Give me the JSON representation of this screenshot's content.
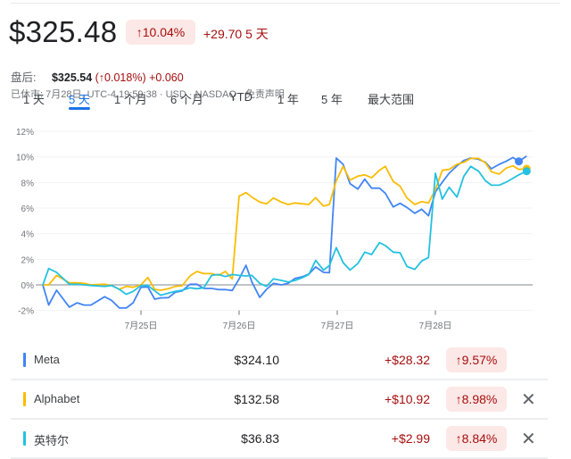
{
  "header": {
    "price": "$325.48",
    "change_pct": "↑10.04%",
    "change_abs": "+29.70",
    "period": "5 天",
    "after_hours_label": "盘后:",
    "after_hours_price": "$325.54",
    "after_hours_pct": "(↑0.018%)",
    "after_hours_change": "+0.060",
    "market_info": "已休市:  7月28日, UTC-4 19:59:38 · USD · NASDAQ · 免责声明"
  },
  "tabs": [
    {
      "label": "1 天",
      "active": false
    },
    {
      "label": "5 天",
      "active": true
    },
    {
      "label": "1 个月",
      "active": false
    },
    {
      "label": "6 个月",
      "active": false
    },
    {
      "label": "YTD",
      "active": false
    },
    {
      "label": "1 年",
      "active": false
    },
    {
      "label": "5 年",
      "active": false
    },
    {
      "label": "最大范围",
      "active": false
    }
  ],
  "chart_data": {
    "type": "line",
    "title": "",
    "xlabel": "",
    "ylabel": "",
    "x_tick_labels": [
      "7月25日",
      "7月26日",
      "7月27日",
      "7月28日"
    ],
    "x_tick_values": [
      25,
      26,
      27,
      28
    ],
    "y_tick_labels": [
      "12%",
      "10%",
      "8%",
      "6%",
      "4%",
      "2%",
      "0%",
      "-2%"
    ],
    "y_tick_values": [
      12,
      10,
      8,
      6,
      4,
      2,
      0,
      -2
    ],
    "xlim": [
      24,
      28.95
    ],
    "ylim": [
      -2,
      12
    ],
    "grid": true,
    "x": [
      24.0,
      24.06,
      24.14,
      24.27,
      24.35,
      24.42,
      24.49,
      24.63,
      24.7,
      24.78,
      24.85,
      24.92,
      25.0,
      25.07,
      25.14,
      25.2,
      25.28,
      25.35,
      25.42,
      25.5,
      25.57,
      25.64,
      25.72,
      25.79,
      25.86,
      25.93,
      26.0,
      26.07,
      26.13,
      26.21,
      26.28,
      26.35,
      26.43,
      26.5,
      26.57,
      26.65,
      26.71,
      26.78,
      26.86,
      26.92,
      26.99,
      27.06,
      27.13,
      27.21,
      27.28,
      27.35,
      27.43,
      27.49,
      27.57,
      27.64,
      27.71,
      27.79,
      27.86,
      27.93,
      28.0,
      28.07,
      28.14,
      28.22,
      28.29,
      28.36,
      28.44,
      28.51,
      28.57,
      28.65,
      28.72,
      28.79,
      28.85,
      28.93
    ],
    "series": [
      {
        "name": "Meta",
        "color": "#4285f4",
        "values": [
          0,
          -1.58,
          -0.42,
          -1.74,
          -1.4,
          -1.58,
          -1.58,
          -0.93,
          -1.21,
          -1.81,
          -1.81,
          -1.4,
          -0.19,
          -0.16,
          -1.12,
          -1.02,
          -1.0,
          -0.58,
          -0.47,
          0.05,
          0.05,
          -0.28,
          -0.28,
          -0.37,
          -0.37,
          -0.44,
          0.47,
          1.53,
          0.23,
          -0.98,
          -0.35,
          0.12,
          0,
          0.12,
          0.51,
          0.65,
          0.84,
          1.4,
          0.98,
          0.95,
          9.91,
          9.42,
          7.91,
          7.49,
          8.26,
          7.56,
          7.56,
          7.16,
          6.09,
          6.37,
          6.05,
          5.6,
          5.91,
          5.4,
          7.26,
          8.02,
          8.72,
          9.3,
          9.72,
          9.91,
          9.81,
          9.58,
          9.07,
          9.42,
          9.65,
          9.95,
          9.65,
          10.07
        ],
        "end_value": 9.65
      },
      {
        "name": "Alphabet",
        "color": "#fbbc04",
        "values": [
          0,
          0,
          0.74,
          0.16,
          0.16,
          0.12,
          0,
          0.05,
          -0.05,
          -0.35,
          -0.12,
          -0.19,
          0,
          0.58,
          -0.35,
          -0.42,
          -0.3,
          -0.12,
          -0.07,
          0.7,
          1.05,
          0.88,
          0.88,
          0.74,
          1.05,
          0.47,
          6.93,
          7.21,
          6.86,
          6.47,
          6.33,
          6.79,
          6.47,
          6.28,
          6.4,
          6.33,
          6.28,
          6.81,
          6.16,
          6.28,
          8.14,
          9.26,
          8.19,
          8.49,
          8.6,
          8.37,
          8.95,
          9.26,
          8.09,
          7.72,
          6.79,
          6.28,
          6.51,
          6.4,
          7.44,
          8.95,
          9.02,
          9.42,
          9.58,
          9.88,
          9.88,
          9.53,
          8.84,
          8.65,
          9.12,
          9.3,
          9.02,
          9.07
        ],
        "end_value": 9.07
      },
      {
        "name": "英特尔",
        "color": "#24c1e0",
        "values": [
          0,
          1.28,
          0.98,
          0.05,
          0.05,
          0,
          -0.05,
          -0.12,
          -0.05,
          -0.35,
          -0.74,
          -0.51,
          -0.05,
          -0.05,
          -0.47,
          -0.81,
          -0.65,
          -0.51,
          -0.42,
          -0.23,
          -0.3,
          -0.23,
          0.74,
          0.81,
          0.65,
          0.81,
          0.74,
          0.7,
          0.74,
          0.12,
          -0.12,
          0.47,
          0.35,
          0.23,
          0.35,
          0.58,
          0.81,
          1.91,
          1.16,
          1.51,
          2.91,
          1.74,
          1.16,
          1.67,
          2.56,
          2.37,
          3.3,
          3.07,
          2.56,
          2.51,
          1.44,
          1.21,
          1.86,
          2.14,
          8.72,
          6.7,
          7.63,
          6.86,
          8.49,
          9.26,
          8.88,
          8.14,
          7.79,
          7.79,
          8.02,
          8.33,
          8.6,
          8.88
        ],
        "end_value": 8.88
      }
    ]
  },
  "comparisons": [
    {
      "name": "Meta",
      "color": "#4285f4",
      "price": "$324.10",
      "change": "+$28.32",
      "pct": "↑9.57%",
      "removable": false
    },
    {
      "name": "Alphabet",
      "color": "#fbbc04",
      "price": "$132.58",
      "change": "+$10.92",
      "pct": "↑8.98%",
      "removable": true
    },
    {
      "name": "英特尔",
      "color": "#24c1e0",
      "price": "$36.83",
      "change": "+$2.99",
      "pct": "↑8.84%",
      "removable": true
    }
  ],
  "icons": {
    "remove": "✕"
  }
}
